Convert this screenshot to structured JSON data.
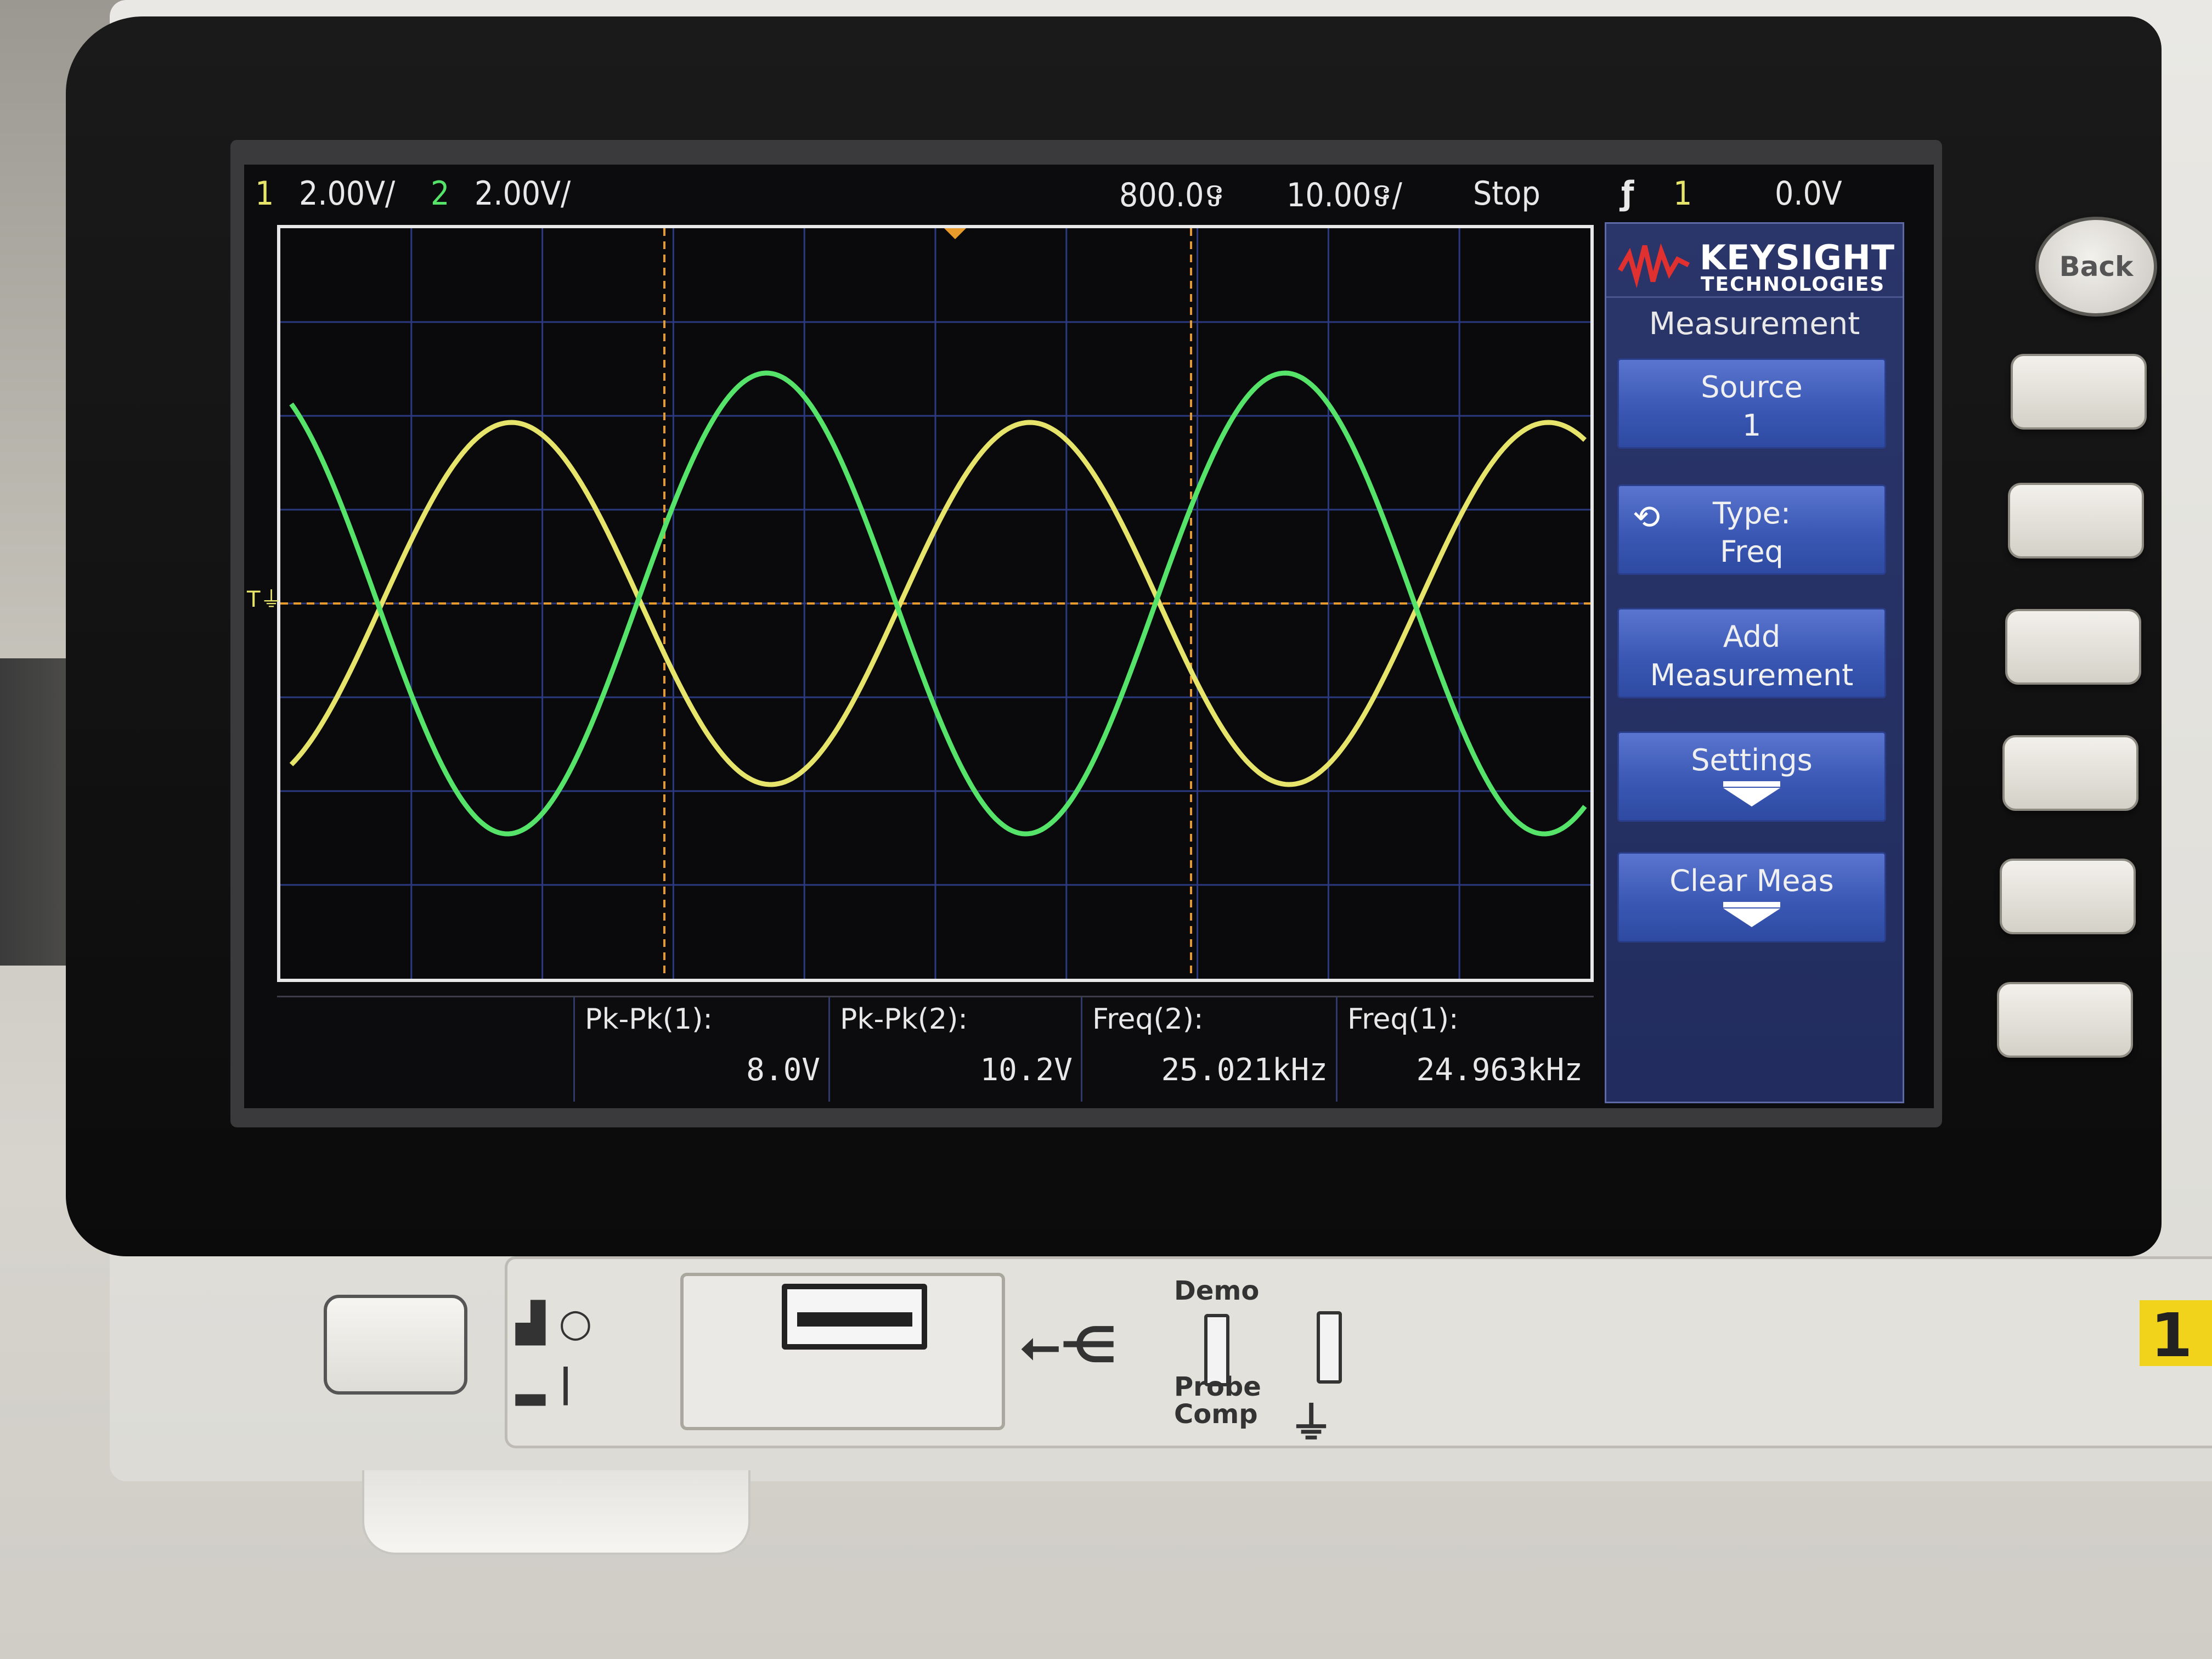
{
  "status_bar": {
    "ch1_label": "1",
    "ch1_scale": "2.00V/",
    "ch2_label": "2",
    "ch2_scale": "2.00V/",
    "time_delay": "800.0ទ",
    "time_scale": "10.00ទ/",
    "run_state": "Stop",
    "trigger_icon": "rising-edge-icon",
    "trigger_source": "1",
    "trigger_level": "0.0V"
  },
  "plot": {
    "ground_marker": "T"
  },
  "measurements": [
    {
      "label": "Pk-Pk(1):",
      "value": "8.0V"
    },
    {
      "label": "Pk-Pk(2):",
      "value": "10.2V"
    },
    {
      "label": "Freq(2):",
      "value": "25.021kHz"
    },
    {
      "label": "Freq(1):",
      "value": "24.963kHz"
    }
  ],
  "side_menu": {
    "brand": "KEYSIGHT",
    "brand_sub": "TECHNOLOGIES",
    "title": "Measurement",
    "softkeys": [
      {
        "line1": "Source",
        "line2": "1"
      },
      {
        "line1": "Type:",
        "line2": "Freq"
      },
      {
        "line1": "Add",
        "line2": "Measurement"
      },
      {
        "line1": "Settings",
        "line2": ""
      },
      {
        "line1": "Clear Meas",
        "line2": ""
      }
    ]
  },
  "hardware": {
    "back_label": "Back",
    "demo_label": "Demo",
    "probe_comp_label_1": "Probe",
    "probe_comp_label_2": "Comp",
    "model_tag": "1"
  },
  "colors": {
    "ch1": "#e6e46a",
    "ch2": "#56e36a",
    "softkey": "#3a58b4",
    "cursor": "#e89a2a"
  }
}
